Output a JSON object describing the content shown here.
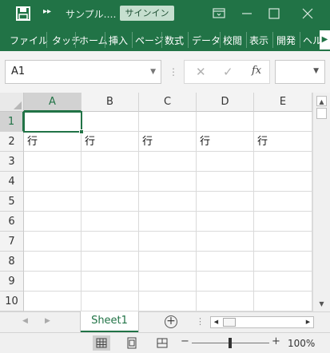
{
  "titlebar": {
    "title": "サンプル.…",
    "signin_label": "サインイン",
    "icons": [
      "save-icon",
      "quick-access-more-icon",
      "ribbon-display-icon",
      "minimize-icon",
      "maximize-icon",
      "close-icon"
    ]
  },
  "ribbon": {
    "tabs": [
      "ファイル",
      "タッチ",
      "ホーム",
      "挿入",
      "ページ",
      "数式",
      "データ",
      "校閲",
      "表示",
      "開発",
      "ヘル"
    ],
    "more_label": "▶"
  },
  "formula_bar": {
    "name_box": "A1",
    "name_box_dropdown": "▼",
    "cancel_icon": "✕",
    "enter_icon": "✓",
    "function_icon": "fx",
    "formula_value": ""
  },
  "sheet": {
    "columns": [
      "A",
      "B",
      "C",
      "D",
      "E"
    ],
    "rows": [
      "1",
      "2",
      "3",
      "4",
      "5",
      "6",
      "7",
      "8",
      "9",
      "10"
    ],
    "cells": [
      [
        "",
        "",
        "",
        "",
        ""
      ],
      [
        "行",
        "行",
        "行",
        "行",
        "行"
      ],
      [
        "",
        "",
        "",
        "",
        ""
      ],
      [
        "",
        "",
        "",
        "",
        ""
      ],
      [
        "",
        "",
        "",
        "",
        ""
      ],
      [
        "",
        "",
        "",
        "",
        ""
      ],
      [
        "",
        "",
        "",
        "",
        ""
      ],
      [
        "",
        "",
        "",
        "",
        ""
      ],
      [
        "",
        "",
        "",
        "",
        ""
      ],
      [
        "",
        "",
        "",
        "",
        ""
      ]
    ],
    "active_cell": "A1"
  },
  "tabs": {
    "sheet_name": "Sheet1",
    "add_label": "+"
  },
  "status": {
    "zoom": "100%",
    "zoom_minus": "−",
    "zoom_plus": "+",
    "views": [
      "normal-view-icon",
      "page-layout-view-icon",
      "page-break-preview-icon"
    ]
  },
  "colors": {
    "accent": "#217346",
    "ribbon": "#217346"
  }
}
